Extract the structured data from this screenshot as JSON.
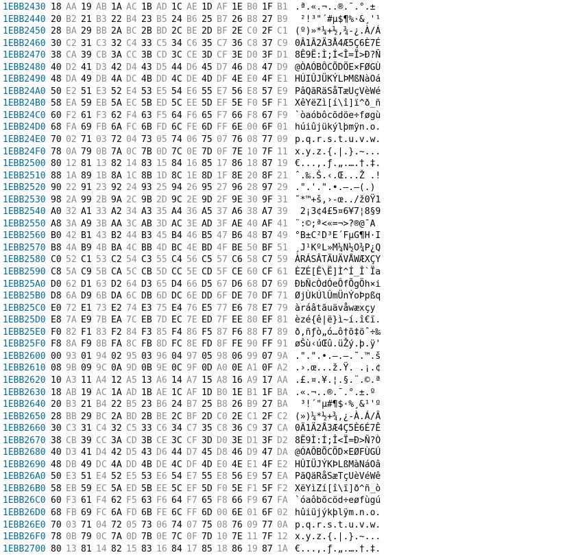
{
  "rows": [
    {
      "addr": "1EBB2430",
      "hex": [
        "18",
        "AA",
        "19",
        "AB",
        "1A",
        "AC",
        "1B",
        "AD",
        "1C",
        "AE",
        "1D",
        "AF",
        "1E",
        "B0",
        "1F",
        "B1"
      ],
      "asc": ".ª.«.¬.­.®.¯.°.±"
    },
    {
      "addr": "1EBB2440",
      "hex": [
        "20",
        "B2",
        "21",
        "B3",
        "22",
        "B4",
        "23",
        "B5",
        "24",
        "B6",
        "25",
        "B7",
        "26",
        "B8",
        "27",
        "B9"
      ],
      "asc": " ²!³\"´#µ$¶%·&¸'¹"
    },
    {
      "addr": "1EBB2450",
      "hex": [
        "28",
        "BA",
        "29",
        "BB",
        "2A",
        "BC",
        "2B",
        "BD",
        "2C",
        "BE",
        "2D",
        "BF",
        "2E",
        "C0",
        "2F",
        "C1"
      ],
      "asc": "(º)»*¼+½,¾-¿.À/Á"
    },
    {
      "addr": "1EBB2460",
      "hex": [
        "30",
        "C2",
        "31",
        "C3",
        "32",
        "C4",
        "33",
        "C5",
        "34",
        "C6",
        "35",
        "C7",
        "36",
        "C8",
        "37",
        "C9"
      ],
      "asc": "0Â1Ã2Ä3Å4Æ5Ç6È7É"
    },
    {
      "addr": "1EBB2470",
      "hex": [
        "38",
        "CA",
        "39",
        "CB",
        "3A",
        "CC",
        "3B",
        "CD",
        "3C",
        "CE",
        "3D",
        "CF",
        "3E",
        "D0",
        "3F",
        "D1"
      ],
      "asc": "8Ê9Ë:Ì;Í<Î=Ï>Ð?Ñ"
    },
    {
      "addr": "1EBB2480",
      "hex": [
        "40",
        "D2",
        "41",
        "D3",
        "42",
        "D4",
        "43",
        "D5",
        "44",
        "D6",
        "45",
        "D7",
        "46",
        "D8",
        "47",
        "D9"
      ],
      "asc": "@ÒAÓBÔCÕDÖE×FØGÙ"
    },
    {
      "addr": "1EBB2490",
      "hex": [
        "48",
        "DA",
        "49",
        "DB",
        "4A",
        "DC",
        "4B",
        "DD",
        "4C",
        "DE",
        "4D",
        "DF",
        "4E",
        "E0",
        "4F",
        "E1"
      ],
      "asc": "HÚIÛJÜKÝLÞMßNàOá"
    },
    {
      "addr": "1EBB24A0",
      "hex": [
        "50",
        "E2",
        "51",
        "E3",
        "52",
        "E4",
        "53",
        "E5",
        "54",
        "E6",
        "55",
        "E7",
        "56",
        "E8",
        "57",
        "E9"
      ],
      "asc": "PâQãRäSåTæUçVèWé"
    },
    {
      "addr": "1EBB24B0",
      "hex": [
        "58",
        "EA",
        "59",
        "EB",
        "5A",
        "EC",
        "5B",
        "ED",
        "5C",
        "EE",
        "5D",
        "EF",
        "5E",
        "F0",
        "5F",
        "F1"
      ],
      "asc": "XêYëZì[í\\î]ï^ð_ñ"
    },
    {
      "addr": "1EBB24C0",
      "hex": [
        "60",
        "F2",
        "61",
        "F3",
        "62",
        "F4",
        "63",
        "F5",
        "64",
        "F6",
        "65",
        "F7",
        "66",
        "F8",
        "67",
        "F9"
      ],
      "asc": "`òaóbôcõdöe÷føgù"
    },
    {
      "addr": "1EBB24D0",
      "hex": [
        "68",
        "FA",
        "69",
        "FB",
        "6A",
        "FC",
        "6B",
        "FD",
        "6C",
        "FE",
        "6D",
        "FF",
        "6E",
        "00",
        "6F",
        "01"
      ],
      "asc": "húiûjükýlþmÿn.o."
    },
    {
      "addr": "1EBB24E0",
      "hex": [
        "70",
        "02",
        "71",
        "03",
        "72",
        "04",
        "73",
        "05",
        "74",
        "06",
        "75",
        "07",
        "76",
        "08",
        "77",
        "09"
      ],
      "asc": "p.q.r.s.t.u.v.w."
    },
    {
      "addr": "1EBB24F0",
      "hex": [
        "78",
        "0A",
        "79",
        "0B",
        "7A",
        "0C",
        "7B",
        "0D",
        "7C",
        "0E",
        "7D",
        "0F",
        "7E",
        "10",
        "7F",
        "11"
      ],
      "asc": "x.y.z.{.|.}.~..."
    },
    {
      "addr": "1EBB2500",
      "hex": [
        "80",
        "12",
        "81",
        "13",
        "82",
        "14",
        "83",
        "15",
        "84",
        "16",
        "85",
        "17",
        "86",
        "18",
        "87",
        "19"
      ],
      "asc": "€...‚.ƒ.„.….†.‡."
    },
    {
      "addr": "1EBB2510",
      "hex": [
        "88",
        "1A",
        "89",
        "1B",
        "8A",
        "1C",
        "8B",
        "1D",
        "8C",
        "1E",
        "8D",
        "1F",
        "8E",
        "20",
        "8F",
        "21"
      ],
      "asc": "ˆ.‰.Š.‹.Œ...Ž .!"
    },
    {
      "addr": "1EBB2520",
      "hex": [
        "90",
        "22",
        "91",
        "23",
        "92",
        "24",
        "93",
        "25",
        "94",
        "26",
        "95",
        "27",
        "96",
        "28",
        "97",
        "29"
      ],
      "asc": ".\".'.\".•.–.—(.)"
    },
    {
      "addr": "1EBB2530",
      "hex": [
        "98",
        "2A",
        "99",
        "2B",
        "9A",
        "2C",
        "9B",
        "2D",
        "9C",
        "2E",
        "9D",
        "2F",
        "9E",
        "30",
        "9F",
        "31"
      ],
      "asc": "˜*™+š,›-œ../ž0Ÿ1"
    },
    {
      "addr": "1EBB2540",
      "hex": [
        "A0",
        "32",
        "A1",
        "33",
        "A2",
        "34",
        "A3",
        "35",
        "A4",
        "36",
        "A5",
        "37",
        "A6",
        "38",
        "A7",
        "39"
      ],
      "asc": " 2¡3¢4£5¤6¥7¦8§9"
    },
    {
      "addr": "1EBB2550",
      "hex": [
        "A8",
        "3A",
        "A9",
        "3B",
        "AA",
        "3C",
        "AB",
        "3D",
        "AC",
        "3E",
        "AD",
        "3F",
        "AE",
        "40",
        "AF",
        "41"
      ],
      "asc": "¨:©;ª<«=¬>­?®@¯A"
    },
    {
      "addr": "1EBB2560",
      "hex": [
        "B0",
        "42",
        "B1",
        "43",
        "B2",
        "44",
        "B3",
        "45",
        "B4",
        "46",
        "B5",
        "47",
        "B6",
        "48",
        "B7",
        "49"
      ],
      "asc": "°B±C²D³E´FµG¶H·I"
    },
    {
      "addr": "1EBB2570",
      "hex": [
        "B8",
        "4A",
        "B9",
        "4B",
        "BA",
        "4C",
        "BB",
        "4D",
        "BC",
        "4E",
        "BD",
        "4F",
        "BE",
        "50",
        "BF",
        "51"
      ],
      "asc": "¸J¹KºL»M¼N½O¾P¿Q"
    },
    {
      "addr": "1EBB2580",
      "hex": [
        "C0",
        "52",
        "C1",
        "53",
        "C2",
        "54",
        "C3",
        "55",
        "C4",
        "56",
        "C5",
        "57",
        "C6",
        "58",
        "C7",
        "59"
      ],
      "asc": "ÀRÁSÂTÃUÄVÅWÆXÇY"
    },
    {
      "addr": "1EBB2590",
      "hex": [
        "C8",
        "5A",
        "C9",
        "5B",
        "CA",
        "5C",
        "CB",
        "5D",
        "CC",
        "5E",
        "CD",
        "5F",
        "CE",
        "60",
        "CF",
        "61"
      ],
      "asc": "ÈZÉ[Ê\\Ë]Ì^Í_Î`Ïa"
    },
    {
      "addr": "1EBB25A0",
      "hex": [
        "D0",
        "62",
        "D1",
        "63",
        "D2",
        "64",
        "D3",
        "65",
        "D4",
        "66",
        "D5",
        "67",
        "D6",
        "68",
        "D7",
        "69"
      ],
      "asc": "ÐbÑcÒdÓeÔfÕgÖh×i"
    },
    {
      "addr": "1EBB25B0",
      "hex": [
        "D8",
        "6A",
        "D9",
        "6B",
        "DA",
        "6C",
        "DB",
        "6D",
        "DC",
        "6E",
        "DD",
        "6F",
        "DE",
        "70",
        "DF",
        "71"
      ],
      "asc": "ØjÙkÚlÛmÜnÝoÞpßq"
    },
    {
      "addr": "1EBB25C0",
      "hex": [
        "E0",
        "72",
        "E1",
        "73",
        "E2",
        "74",
        "E3",
        "75",
        "E4",
        "76",
        "E5",
        "77",
        "E6",
        "78",
        "E7",
        "79"
      ],
      "asc": "àráâtãuävåwæxçy"
    },
    {
      "addr": "1EBB25D0",
      "hex": [
        "E8",
        "7A",
        "E9",
        "7B",
        "EA",
        "7C",
        "EB",
        "7D",
        "EC",
        "7E",
        "ED",
        "7F",
        "EE",
        "80",
        "EF",
        "81"
      ],
      "asc": "èzé{ê|ë}ì~í.î€ï."
    },
    {
      "addr": "1EBB25E0",
      "hex": [
        "F0",
        "82",
        "F1",
        "83",
        "F2",
        "84",
        "F3",
        "85",
        "F4",
        "86",
        "F5",
        "87",
        "F6",
        "88",
        "F7",
        "89"
      ],
      "asc": "ð‚ñƒò„ó…ô†õ‡öˆ÷‰"
    },
    {
      "addr": "1EBB25F0",
      "hex": [
        "F8",
        "8A",
        "F9",
        "8B",
        "FA",
        "8C",
        "FB",
        "8D",
        "FC",
        "8E",
        "FD",
        "8F",
        "FE",
        "90",
        "FF",
        "91"
      ],
      "asc": "øŠù‹úŒû.üŽý.þ.ÿ'"
    },
    {
      "addr": "1EBB2600",
      "hex": [
        "00",
        "93",
        "01",
        "94",
        "02",
        "95",
        "03",
        "96",
        "04",
        "97",
        "05",
        "98",
        "06",
        "99",
        "07",
        "9A"
      ],
      "asc": ".\".\".•.–.—.˜.™.š"
    },
    {
      "addr": "1EBB2610",
      "hex": [
        "08",
        "9B",
        "09",
        "9C",
        "0A",
        "9D",
        "0B",
        "9E",
        "0C",
        "9F",
        "0D",
        "A0",
        "0E",
        "A1",
        "0F",
        "A2"
      ],
      "asc": ".›.œ...ž.Ÿ. .¡.¢"
    },
    {
      "addr": "1EBB2620",
      "hex": [
        "10",
        "A3",
        "11",
        "A4",
        "12",
        "A5",
        "13",
        "A6",
        "14",
        "A7",
        "15",
        "A8",
        "16",
        "A9",
        "17",
        "AA"
      ],
      "asc": ".£.¤.¥.¦.§.¨.©.ª"
    },
    {
      "addr": "1EBB2630",
      "hex": [
        "18",
        "AB",
        "19",
        "AC",
        "1A",
        "AD",
        "1B",
        "AE",
        "1C",
        "AF",
        "1D",
        "B0",
        "1E",
        "B1",
        "1F",
        "BA"
      ],
      "asc": ".«.¬.­.®.¯.°.±.º"
    },
    {
      "addr": "1EBB2640",
      "hex": [
        "20",
        "B3",
        "21",
        "B4",
        "22",
        "B5",
        "23",
        "B6",
        "24",
        "B7",
        "25",
        "B8",
        "26",
        "B9",
        "27",
        "BA"
      ],
      "asc": " ³!´\"µ#¶$·%¸&¹'º"
    },
    {
      "addr": "1EBB2650",
      "hex": [
        "28",
        "BB",
        "29",
        "BC",
        "2A",
        "BD",
        "2B",
        "BE",
        "2C",
        "BF",
        "2D",
        "C0",
        "2E",
        "C1",
        "2F",
        "C2"
      ],
      "asc": "(»)¼*½+¾,¿-À.Á/Â"
    },
    {
      "addr": "1EBB2660",
      "hex": [
        "30",
        "C3",
        "31",
        "C4",
        "32",
        "C5",
        "33",
        "C6",
        "34",
        "C7",
        "35",
        "C8",
        "36",
        "C9",
        "37",
        "CA"
      ],
      "asc": "0Ã1Ä2Å3Æ4Ç5È6É7Ê"
    },
    {
      "addr": "1EBB2670",
      "hex": [
        "38",
        "CB",
        "39",
        "CC",
        "3A",
        "CD",
        "3B",
        "CE",
        "3C",
        "CF",
        "3D",
        "D0",
        "3E",
        "D1",
        "3F",
        "D2"
      ],
      "asc": "8Ë9Ì:Í;Î<Ï=Ð>Ñ?Ò"
    },
    {
      "addr": "1EBB2680",
      "hex": [
        "40",
        "D3",
        "41",
        "D4",
        "42",
        "D5",
        "43",
        "D6",
        "44",
        "D7",
        "45",
        "D8",
        "46",
        "D9",
        "47",
        "DA"
      ],
      "asc": "@ÓAÔBÕCÖD×EØFÙGÚ"
    },
    {
      "addr": "1EBB2690",
      "hex": [
        "48",
        "DB",
        "49",
        "DC",
        "4A",
        "DD",
        "4B",
        "DE",
        "4C",
        "DF",
        "4D",
        "E0",
        "4E",
        "E1",
        "4F",
        "E2"
      ],
      "asc": "HÛIÜJÝKÞLßMàNáOâ"
    },
    {
      "addr": "1EBB26A0",
      "hex": [
        "50",
        "E3",
        "51",
        "E4",
        "52",
        "E5",
        "53",
        "E6",
        "54",
        "E7",
        "55",
        "E8",
        "56",
        "E9",
        "57",
        "EA"
      ],
      "asc": "PãQäRåSæTçUèVéWê"
    },
    {
      "addr": "1EBB26B0",
      "hex": [
        "58",
        "EB",
        "59",
        "EC",
        "5A",
        "ED",
        "5B",
        "EE",
        "5C",
        "EF",
        "5D",
        "F0",
        "5E",
        "F1",
        "5F",
        "F2"
      ],
      "asc": "XëYìZí[î\\ï]ð^ñ_ò"
    },
    {
      "addr": "1EBB26C0",
      "hex": [
        "60",
        "F3",
        "61",
        "F4",
        "62",
        "F5",
        "63",
        "F6",
        "64",
        "F7",
        "65",
        "F8",
        "66",
        "F9",
        "67",
        "FA"
      ],
      "asc": "`óaôbõcöd÷eøfùgú"
    },
    {
      "addr": "1EBB26D0",
      "hex": [
        "68",
        "FB",
        "69",
        "FC",
        "6A",
        "FD",
        "6B",
        "FE",
        "6C",
        "FF",
        "6D",
        "00",
        "6E",
        "01",
        "6F",
        "02"
      ],
      "asc": "hûiüjýkþlÿm.n.o."
    },
    {
      "addr": "1EBB26E0",
      "hex": [
        "70",
        "03",
        "71",
        "04",
        "72",
        "05",
        "73",
        "06",
        "74",
        "07",
        "75",
        "08",
        "76",
        "09",
        "77",
        "0A"
      ],
      "asc": "p.q.r.s.t.u.v.w."
    },
    {
      "addr": "1EBB26F0",
      "hex": [
        "78",
        "0B",
        "79",
        "0C",
        "7A",
        "0D",
        "7B",
        "0E",
        "7C",
        "0F",
        "7D",
        "10",
        "7E",
        "11",
        "7F",
        "12"
      ],
      "asc": "x.y.z.{.|.}.~..."
    },
    {
      "addr": "1EBB2700",
      "hex": [
        "80",
        "13",
        "81",
        "14",
        "82",
        "15",
        "83",
        "16",
        "84",
        "17",
        "85",
        "18",
        "86",
        "19",
        "87",
        "1A"
      ],
      "asc": "€...‚.ƒ.„.….†.‡."
    }
  ]
}
